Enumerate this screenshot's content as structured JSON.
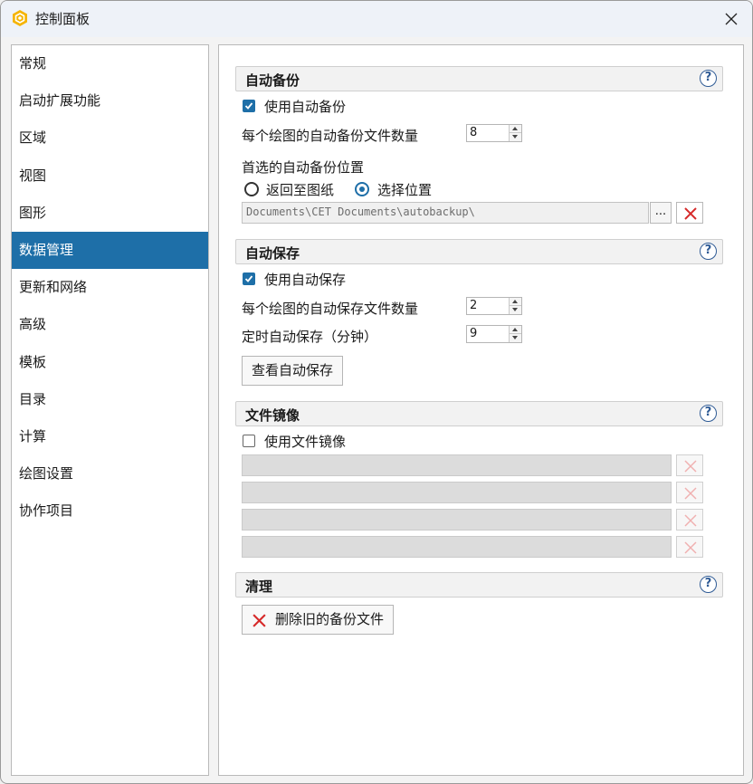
{
  "window": {
    "title": "控制面板"
  },
  "sidebar": {
    "items": [
      {
        "label": "常规"
      },
      {
        "label": "启动扩展功能"
      },
      {
        "label": "区域"
      },
      {
        "label": "视图"
      },
      {
        "label": "图形"
      },
      {
        "label": "数据管理",
        "active": true
      },
      {
        "label": "更新和网络"
      },
      {
        "label": "高级"
      },
      {
        "label": "模板"
      },
      {
        "label": "目录"
      },
      {
        "label": "计算"
      },
      {
        "label": "绘图设置"
      },
      {
        "label": "协作项目"
      }
    ]
  },
  "auto_backup": {
    "header": "自动备份",
    "use_label": "使用自动备份",
    "use_checked": true,
    "count_label": "每个绘图的自动备份文件数量",
    "count_value": "8",
    "location_label": "首选的自动备份位置",
    "radio_return": "返回至图纸",
    "radio_choose": "选择位置",
    "selected_radio": "选择位置",
    "path": "Documents\\CET Documents\\autobackup\\",
    "browse_label": "..."
  },
  "auto_save": {
    "header": "自动保存",
    "use_label": "使用自动保存",
    "use_checked": true,
    "count_label": "每个绘图的自动保存文件数量",
    "count_value": "2",
    "interval_label": "定时自动保存（分钟）",
    "interval_value": "9",
    "view_button": "查看自动保存"
  },
  "file_mirror": {
    "header": "文件镜像",
    "use_label": "使用文件镜像",
    "use_checked": false,
    "paths": [
      "",
      "",
      "",
      ""
    ]
  },
  "cleanup": {
    "header": "清理",
    "delete_button": "删除旧的备份文件"
  },
  "help_glyph": "?",
  "colors": {
    "accent": "#1e6fa8",
    "delete_red": "#d62a2a",
    "header_bg": "#f2f2f2"
  }
}
